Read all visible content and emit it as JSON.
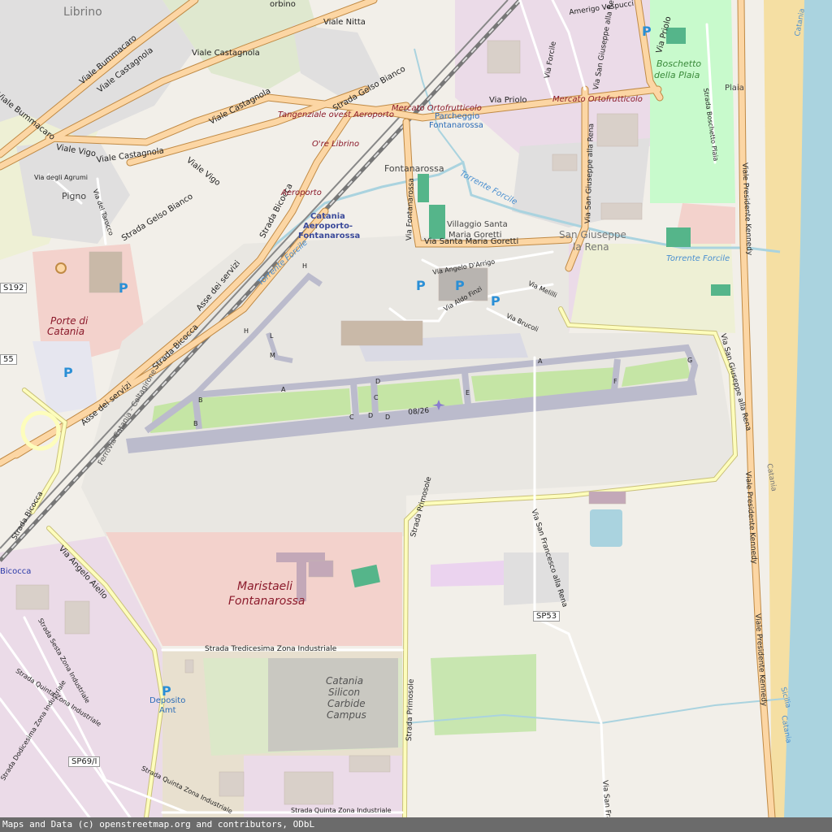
{
  "map": {
    "places": {
      "librino": "Librino",
      "pigno": "Pigno",
      "fontanarossa": "Fontanarossa",
      "villaggio1": "Villaggio Santa",
      "villaggio2": "Maria Goretti",
      "sangiuseppe1": "San Giuseppe",
      "sangiuseppe2": "la Rena",
      "plaia": "Plaia",
      "bicocca": "Bicocca",
      "catania_beach1": "Catania",
      "catania_beach2": "Catania",
      "sicilia": "Sicilia",
      "catania_beach3": "Catania"
    },
    "roads": {
      "viale_nitta": "Viale Nitta",
      "viale_castagnola_a": "Viale Castagnola",
      "viale_castagnola_b": "Viale Castagnola",
      "viale_castagnola_c": "Viale Castagnola",
      "viale_castagnola_d": "Viale Castagnola",
      "viale_bummacaro_a": "Viale Bummacaro",
      "viale_bummacaro_b": "Viale Bummacaro",
      "viale_vigo_a": "Viale Vigo",
      "viale_vigo_b": "Viale Vigo",
      "via_degli_agrumi": "Via degli Agrumi",
      "via_del_tarocco": "Via del Tarocco",
      "strada_gelso_bianco_a": "Strada Gelso Bianco",
      "strada_gelso_bianco_b": "Strada Gelso Bianco",
      "tangenziale": "Tangenziale ovest Aeroporto",
      "mercato_a": "Mercato Ortofrutticolo",
      "mercato_b": "Mercato Ortofrutticolo",
      "via_priolo_a": "Via Priolo",
      "via_priolo_b": "Via Priolo",
      "amerigo": "Amerigo Vespucci",
      "via_forcile": "Via Forcile",
      "via_san_giuseppe_alla_rena_a": "Via San Giuseppe alla Rena",
      "via_san_giuseppe_alla_rena_b": "Via San Giuseppe alla Rena",
      "via_san_giuseppe_alla_rena_c": "Via San Giuseppe alla Rena",
      "strada_boschetto_plaia": "Strada Boschetto Plaia",
      "viale_presidente_kennedy_a": "Viale Presidente Kennedy",
      "viale_presidente_kennedy_b": "Viale Presidente Kennedy",
      "viale_presidente_kennedy_c": "Viale Presidente Kennedy",
      "via_fontanarossa": "Via Fontanarossa",
      "via_santa_maria_goretti": "Via Santa Maria Goretti",
      "via_angelo_darrigo": "Via Angelo D'Arrigo",
      "via_aldo_finzi": "Via Aldo Finzi",
      "via_melilli": "Via Melilli",
      "via_brucoli": "Via Brucoli",
      "strada_bicocca_a": "Strada Bicocca",
      "strada_bicocca_b": "Strada Bicocca",
      "strada_bicocca_c": "Strada Bicocca",
      "asse_servizi_a": "Asse dei servizi",
      "asse_servizi_b": "Asse dei servizi",
      "ferrovia": "Ferrovia Catania - Caltagirone",
      "via_angelo_aiello": "Via Angelo Aiello",
      "strada_primosole_a": "Strada Primosole",
      "strada_primosole_b": "Strada Primosole",
      "via_san_francesco_a": "Via San Francesco alla Rena",
      "via_san_francesco_b": "Via San Francesco",
      "strada_tredicesima": "Strada Tredicesima Zona Industriale",
      "strada_sesta": "Strada Sesta Zona Industriale",
      "strada_quinta_a": "Strada Quinta Zona Industriale",
      "strada_quinta_b": "Strada Quinta Zona Industriale",
      "strada_quinta_c": "Strada Quinta Zona Industriale",
      "strada_dodicesima": "Strada Dodicesima Zona Industriale",
      "runway": "08/26",
      "tw_a1": "A",
      "tw_a2": "A",
      "tw_b1": "B",
      "tw_b2": "B",
      "tw_c1": "C",
      "tw_c2": "C",
      "tw_d1": "D",
      "tw_d2": "D",
      "tw_d3": "D",
      "tw_e": "E",
      "tw_f": "F",
      "tw_g": "G",
      "tw_h1": "H",
      "tw_h2": "H",
      "tw_l": "L",
      "tw_m": "M",
      "sorbino": "orbino"
    },
    "pois": {
      "aeroporto": "Aeroporto",
      "ore_librino": "O're Librino",
      "parcheggio1": "Parcheggio",
      "parcheggio2": "Fontanarossa",
      "catania_airport1": "Catania",
      "catania_airport2": "Aeroporto-",
      "catania_airport3": "Fontanarossa",
      "porte1": "Porte di",
      "porte2": "Catania",
      "boschetto1": "Boschetto",
      "boschetto2": "della Plaia",
      "maristaeli1": "Maristaeli",
      "maristaeli2": "Fontanarossa",
      "silicon1": "Catania",
      "silicon2": "Silicon",
      "silicon3": "Carbide",
      "silicon4": "Campus",
      "deposito1": "Deposito",
      "deposito2": "Amt"
    },
    "water": {
      "torrente_forcile_a": "Torrente Forcile",
      "torrente_forcile_b": "Torrente Forcile",
      "torrente_forcile_c": "Torrente Forcile"
    },
    "parking": "P",
    "shields": {
      "s192": "S192",
      "s55": "55",
      "sp53": "SP53",
      "sp69": "SP69/I"
    },
    "colors": {
      "land": "#f2efe9",
      "sea": "#aad3df",
      "beach": "#f5dfa3",
      "residential": "#e0dfdf",
      "industrial": "#ebdbe8",
      "park": "#c8facc",
      "farmland": "#eef0d5",
      "military": "#f3d2cc",
      "runway": "#bbbbcc",
      "primary_road": "#fcd6a4",
      "road_casing": "#c08a45",
      "tertiary_road": "#fdfdbc"
    }
  },
  "attribution": "Maps and Data (c) openstreetmap.org and contributors, ODbL"
}
